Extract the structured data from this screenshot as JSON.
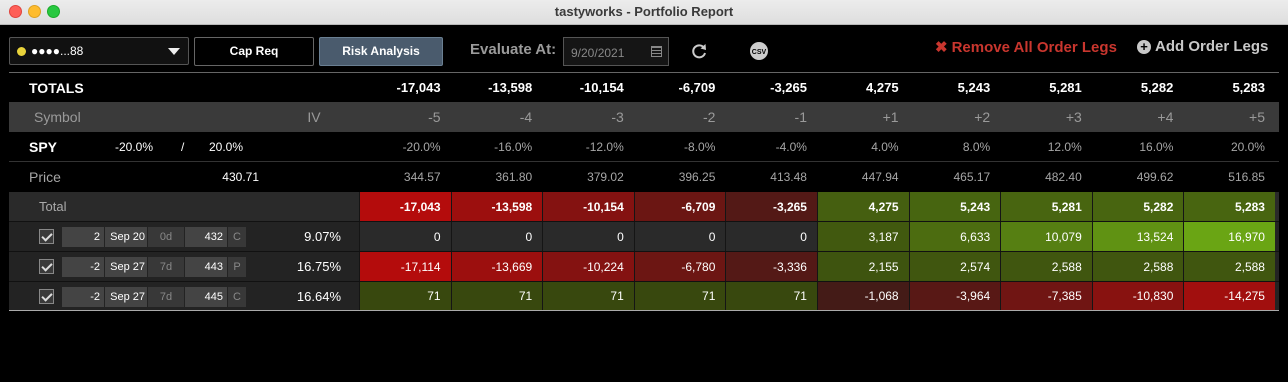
{
  "window": {
    "title": "tastyworks - Portfolio Report"
  },
  "toolbar": {
    "account": "●●●●...88",
    "cap_req": "Cap Req",
    "risk_analysis": "Risk Analysis",
    "evaluate_label": "Evaluate At:",
    "evaluate_date": "9/20/2021",
    "csv_label": "CSV",
    "remove_legs": "Remove All Order Legs",
    "add_legs": "Add Order Legs"
  },
  "totals": {
    "label": "TOTALS",
    "values": [
      "-17,043",
      "-13,598",
      "-10,154",
      "-6,709",
      "-3,265",
      "4,275",
      "5,243",
      "5,281",
      "5,282",
      "5,283"
    ]
  },
  "header": {
    "symbol": "Symbol",
    "iv": "IV",
    "steps": [
      "-5",
      "-4",
      "-3",
      "-2",
      "-1",
      "+1",
      "+2",
      "+3",
      "+4",
      "+5"
    ]
  },
  "spy": {
    "symbol": "SPY",
    "low_pct": "-20.0%",
    "sep": "/",
    "high_pct": "20.0%",
    "pcts": [
      "-20.0%",
      "-16.0%",
      "-12.0%",
      "-8.0%",
      "-4.0%",
      "4.0%",
      "8.0%",
      "12.0%",
      "16.0%",
      "20.0%"
    ]
  },
  "price": {
    "label": "Price",
    "current": "430.71",
    "values": [
      "344.57",
      "361.80",
      "379.02",
      "396.25",
      "413.48",
      "447.94",
      "465.17",
      "482.40",
      "499.62",
      "516.85"
    ]
  },
  "total_row": {
    "label": "Total",
    "values": [
      "-17,043",
      "-13,598",
      "-10,154",
      "-6,709",
      "-3,265",
      "4,275",
      "5,243",
      "5,281",
      "5,282",
      "5,283"
    ]
  },
  "legs": [
    {
      "qty": "2",
      "exp": "Sep 20",
      "dte": "0d",
      "strike": "432",
      "type": "C",
      "iv": "9.07%",
      "values": [
        "0",
        "0",
        "0",
        "0",
        "0",
        "3,187",
        "6,633",
        "10,079",
        "13,524",
        "16,970"
      ]
    },
    {
      "qty": "-2",
      "exp": "Sep 27",
      "dte": "7d",
      "strike": "443",
      "type": "P",
      "iv": "16.75%",
      "values": [
        "-17,114",
        "-13,669",
        "-10,224",
        "-6,780",
        "-3,336",
        "2,155",
        "2,574",
        "2,588",
        "2,588",
        "2,588"
      ]
    },
    {
      "qty": "-2",
      "exp": "Sep 27",
      "dte": "7d",
      "strike": "445",
      "type": "C",
      "iv": "16.64%",
      "values": [
        "71",
        "71",
        "71",
        "71",
        "71",
        "-1,068",
        "-3,964",
        "-7,385",
        "-10,830",
        "-14,275"
      ]
    }
  ],
  "colors": {
    "loss_strong": "#b0140e",
    "gain_strong": "#6aa514",
    "neutral": "#2f2f2f",
    "remove": "#c9362e",
    "risk_button": "#4a5b6d"
  }
}
